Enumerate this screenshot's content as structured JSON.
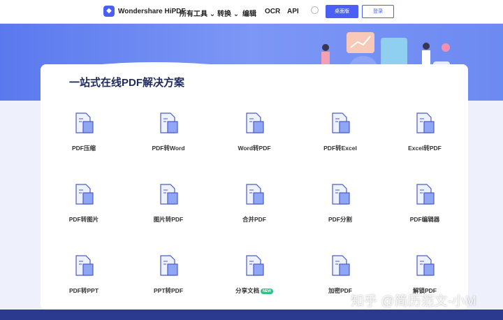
{
  "header": {
    "brand": "Wondershare HiPDF",
    "nav": [
      "所有工具 ⌄",
      "转换 ⌄",
      "编辑",
      "OCR",
      "API"
    ],
    "desktop_btn": "桌面版",
    "login_btn": "登录"
  },
  "main": {
    "title": "一站式在线PDF解决方案",
    "tools": [
      {
        "label": "PDF压缩",
        "icon": "compress-icon"
      },
      {
        "label": "PDF转Word",
        "icon": "pdf-to-word-icon"
      },
      {
        "label": "Word转PDF",
        "icon": "word-to-pdf-icon"
      },
      {
        "label": "PDF转Excel",
        "icon": "pdf-to-excel-icon"
      },
      {
        "label": "Excel转PDF",
        "icon": "excel-to-pdf-icon"
      },
      {
        "label": "PDF转图片",
        "icon": "pdf-to-image-icon"
      },
      {
        "label": "图片转PDF",
        "icon": "image-to-pdf-icon"
      },
      {
        "label": "合并PDF",
        "icon": "merge-icon"
      },
      {
        "label": "PDF分割",
        "icon": "split-icon"
      },
      {
        "label": "PDF编辑器",
        "icon": "editor-icon"
      },
      {
        "label": "PDF转PPT",
        "icon": "pdf-to-ppt-icon"
      },
      {
        "label": "PPT转PDF",
        "icon": "ppt-to-pdf-icon"
      },
      {
        "label": "分享文档",
        "icon": "share-icon",
        "badge": "NEW"
      },
      {
        "label": "加密PDF",
        "icon": "lock-icon"
      },
      {
        "label": "解锁PDF",
        "icon": "unlock-icon"
      }
    ]
  },
  "watermark": "知乎 @简历范文-小M",
  "colors": {
    "accent": "#4c5ff5",
    "hero": "#6d8af2",
    "footer": "#2b3a8e"
  }
}
